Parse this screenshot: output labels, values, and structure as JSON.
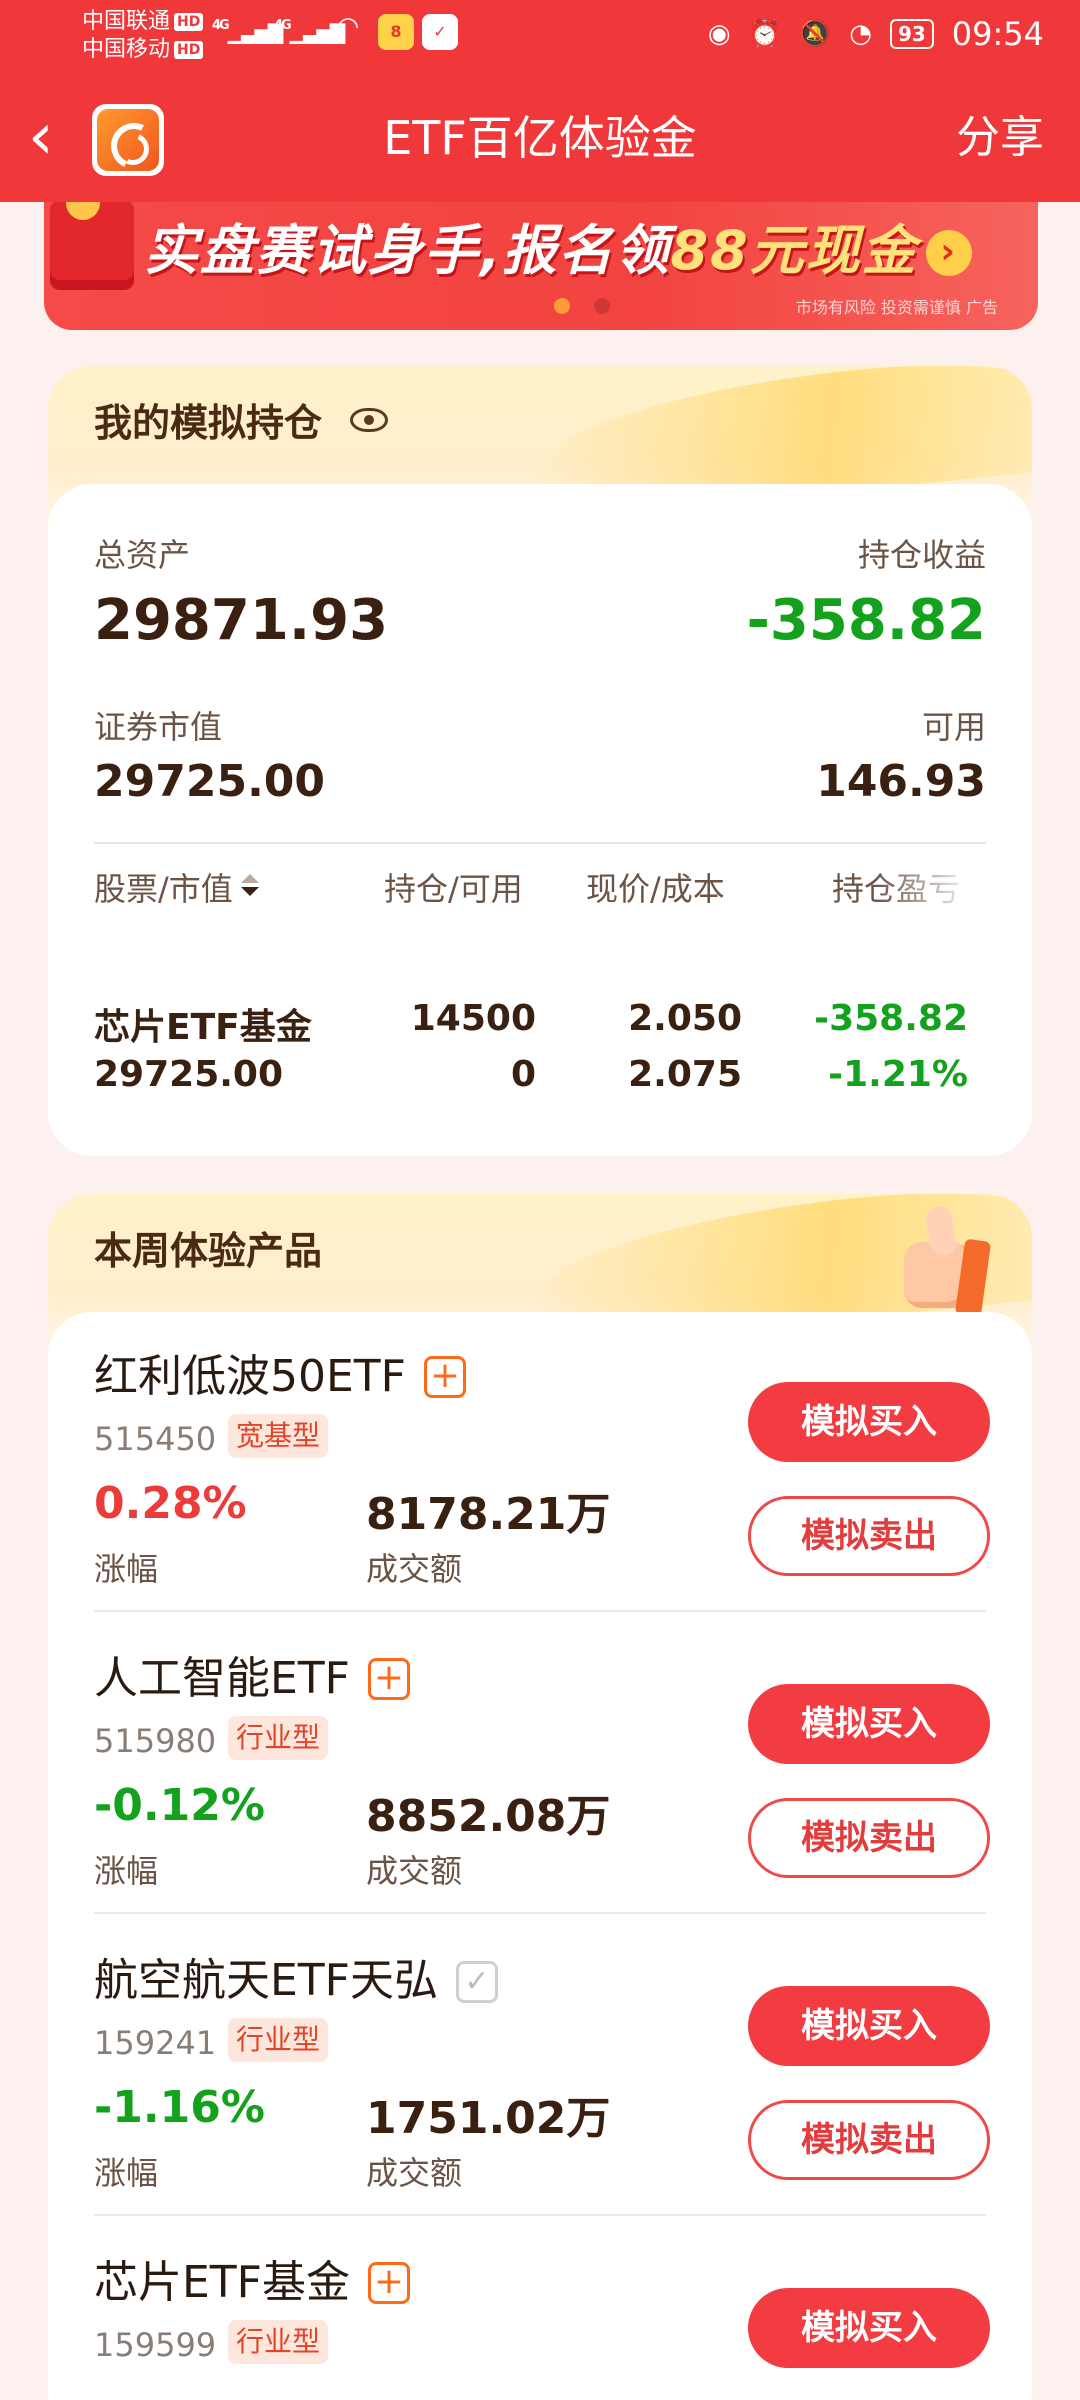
{
  "status": {
    "carrier1": "中国联通",
    "carrier2": "中国移动",
    "hd": "HD",
    "net1": "4G",
    "net2": "4G",
    "battery": "93",
    "time": "09:54"
  },
  "nav": {
    "back": "‹",
    "title": "ETF百亿体验金",
    "share": "分享"
  },
  "banner": {
    "text_a": "实盘赛试身手,报名领",
    "text_b": "88元现金",
    "arrow": "›",
    "disclaimer": "市场有风险 投资需谨慎 广告"
  },
  "holdings": {
    "title": "我的模拟持仓",
    "total_assets_label": "总资产",
    "total_assets": "29871.93",
    "profit_label": "持仓收益",
    "profit": "-358.82",
    "market_value_label": "证券市值",
    "market_value": "29725.00",
    "available_label": "可用",
    "available": "146.93",
    "columns": [
      "股票/市值",
      "持仓/可用",
      "现价/成本",
      "持仓盈亏"
    ],
    "rows": [
      {
        "name": "芯片ETF基金",
        "market_value": "29725.00",
        "position": "14500",
        "available": "0",
        "price": "2.050",
        "cost": "2.075",
        "pnl": "-358.82",
        "pnl_pct": "-1.21%"
      }
    ]
  },
  "products": {
    "title": "本周体验产品",
    "buy_label": "模拟买入",
    "sell_label": "模拟卖出",
    "change_label": "涨幅",
    "volume_label": "成交额",
    "items": [
      {
        "name": "红利低波50ETF",
        "code": "515450",
        "tag": "宽基型",
        "change": "0.28%",
        "volume": "8178.21万",
        "added": false
      },
      {
        "name": "人工智能ETF",
        "code": "515980",
        "tag": "行业型",
        "change": "-0.12%",
        "volume": "8852.08万",
        "added": false
      },
      {
        "name": "航空航天ETF天弘",
        "code": "159241",
        "tag": "行业型",
        "change": "-1.16%",
        "volume": "1751.02万",
        "added": true
      },
      {
        "name": "芯片ETF基金",
        "code": "159599",
        "tag": "行业型",
        "change": "",
        "volume": "",
        "added": false
      }
    ]
  },
  "colors": {
    "brand_red": "#f0373a",
    "up": "#ec3b3b",
    "down": "#14a21e",
    "accent_orange": "#ff6a1a"
  }
}
